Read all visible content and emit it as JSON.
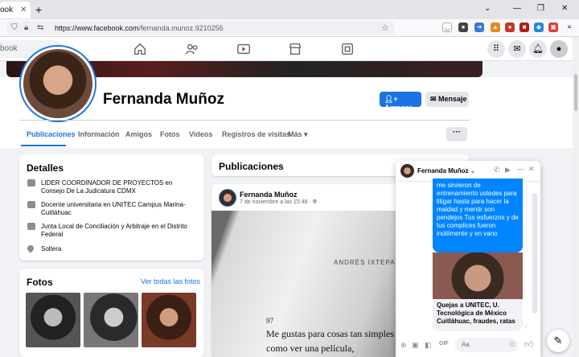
{
  "browser": {
    "tab_label": "ook",
    "url_host": "https://www.facebook.com",
    "url_path": "/fernanda.munoz.9210256"
  },
  "fb": {
    "search_placeholder": "book",
    "profile": {
      "name": "Fernanda Muñoz",
      "add_label": "Agregar",
      "message_label": "Mensaje"
    },
    "tabs": [
      "Publicaciones",
      "Información",
      "Amigos",
      "Fotos",
      "Videos",
      "Registros de visitas",
      "Más"
    ],
    "details": {
      "title": "Detalles",
      "items": [
        "LIDER COORDINADOR DE PROYECTOS en Consejo De La Judicatura CDMX",
        "Docente universitaria en UNITEC Campus Marina-Cuitláhuac",
        "Junta Local de Conciliación y Arbitraje en el Distrito Federal",
        "Soltera"
      ]
    },
    "photos": {
      "title": "Fotos",
      "see_all": "Ver todas las fotos"
    },
    "posts": {
      "title": "Publicaciones",
      "author": "Fernanda Muñoz",
      "date": "7 de noviembre a las 15:48 · ",
      "book_header": "ANDRÉS IXTEPAN",
      "book_page": "97",
      "book_line1": "Me gustas para cosas tan simples",
      "book_line2": "como ver una película,"
    },
    "chat": {
      "name": "Fernanda Muñoz",
      "message": "me sirvieron de entrenamiento ustedes para litigar hasta para hacer la maldad y mentir son pendejos Tus esfuerzos y de tus complices fueron inútilmente y en vano",
      "caption": "Quejas a UNITEC, U. Tecnológica de México Cuitláhuac, fraudes, ratas",
      "input_placeholder": "Aa"
    }
  }
}
